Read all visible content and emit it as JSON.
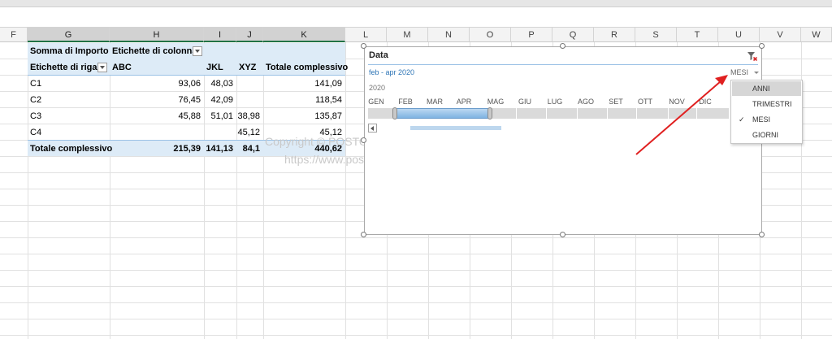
{
  "columns": [
    "F",
    "G",
    "H",
    "I",
    "J",
    "K",
    "L",
    "M",
    "N",
    "O",
    "P",
    "Q",
    "R",
    "S",
    "T",
    "U",
    "V",
    "W"
  ],
  "pivot": {
    "value_label": "Somma di Importo",
    "col_labels": "Etichette di colonna",
    "row_labels": "Etichette di riga",
    "headers": [
      "ABC",
      "JKL",
      "XYZ",
      "Totale complessivo"
    ],
    "rows": [
      {
        "label": "C1",
        "abc": "93,06",
        "jkl": "48,03",
        "xyz": "",
        "total": "141,09"
      },
      {
        "label": "C2",
        "abc": "76,45",
        "jkl": "42,09",
        "xyz": "",
        "total": "118,54"
      },
      {
        "label": "C3",
        "abc": "45,88",
        "jkl": "51,01",
        "xyz": "38,98",
        "total": "135,87"
      },
      {
        "label": "C4",
        "abc": "",
        "jkl": "",
        "xyz": "45,12",
        "total": "45,12"
      }
    ],
    "grand_total": {
      "label": "Totale complessivo",
      "abc": "215,39",
      "jkl": "141,13",
      "xyz": "84,1",
      "total": "440,62"
    }
  },
  "watermark": {
    "line1": "Copyright © POSTOPIT (R)",
    "line2": "https://www.postopit.it"
  },
  "slicer": {
    "title": "Data",
    "range_label": "feb - apr 2020",
    "level_label": "MESI",
    "year": "2020",
    "months": [
      "GEN",
      "FEB",
      "MAR",
      "APR",
      "MAG",
      "GIU",
      "LUG",
      "AGO",
      "SET",
      "OTT",
      "NOV",
      "DIC"
    ],
    "selected_start_month": "FEB",
    "selected_end_month": "APR",
    "accent_color": "#2e75b6",
    "arrow_color": "#e02020"
  },
  "level_menu": {
    "items": [
      "ANNI",
      "TRIMESTRI",
      "MESI",
      "GIORNI"
    ],
    "highlighted": "ANNI",
    "checked": "MESI"
  }
}
